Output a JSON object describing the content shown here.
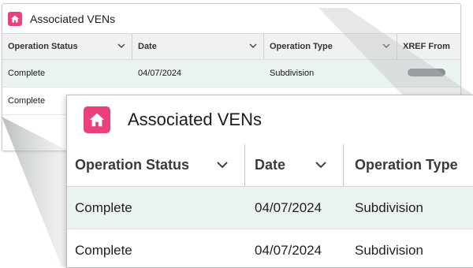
{
  "panel": {
    "title": "Associated VENs",
    "columns": [
      {
        "label": "Operation Status"
      },
      {
        "label": "Date"
      },
      {
        "label": "Operation Type"
      },
      {
        "label": "XREF From"
      }
    ],
    "rows": [
      {
        "status": "Complete",
        "date": "04/07/2024",
        "type": "Subdivision"
      },
      {
        "status": "Complete",
        "date": "04/07/2024",
        "type": "Subdivision"
      }
    ]
  },
  "icons": {
    "header": "home-icon",
    "column_menu": "chevron-down-icon"
  },
  "colors": {
    "accent": "#e8417d",
    "row_highlight": "#eaf3f2",
    "header_bg": "#f0f1f2"
  }
}
